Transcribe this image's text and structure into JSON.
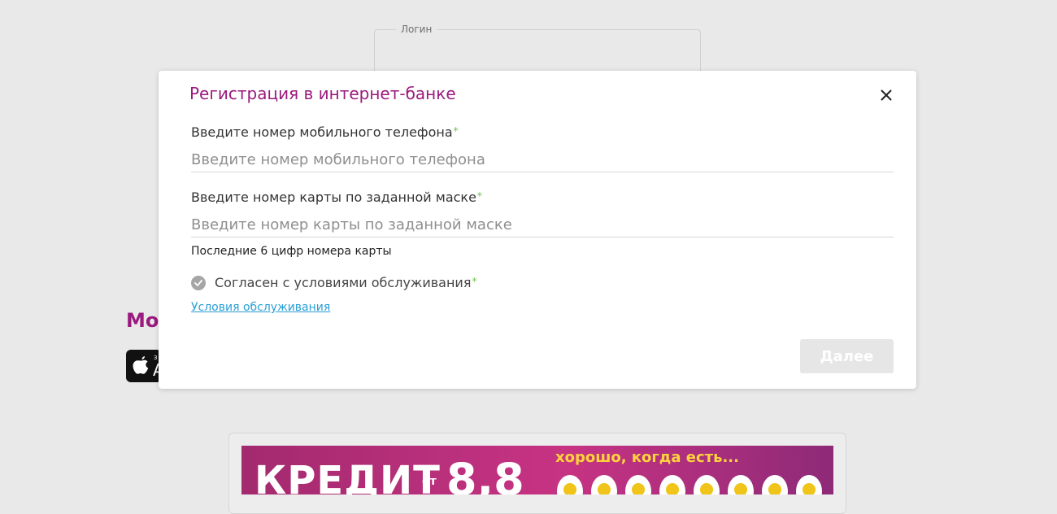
{
  "background": {
    "login_legend": "Логин",
    "mobile_title": "Мобильный банк",
    "appstore_small": "З",
    "appstore_big": "A",
    "banner": {
      "word": "КРЕДИТ",
      "from": "от",
      "number": "8,8",
      "slogan": "хорошо, когда есть..."
    }
  },
  "modal": {
    "title": "Регистрация в интернет-банке",
    "close_icon": "close-icon",
    "phone": {
      "label": "Введите номер мобильного телефона",
      "required_mark": "*",
      "placeholder": "Введите номер мобильного телефона",
      "value": ""
    },
    "card": {
      "label": "Введите номер карты по заданной маске",
      "required_mark": "*",
      "placeholder": "Введите номер карты по заданной маске",
      "value": ""
    },
    "card_hint": "Последние 6 цифр номера карты",
    "agree": {
      "label": "Согласен с условиями обслуживания",
      "required_mark": "*",
      "checked": true
    },
    "terms_link": "Условия обслуживания",
    "next_label": "Далее"
  },
  "colors": {
    "brand": "#9a1a7e",
    "required": "#6cc04a",
    "link": "#2a9fd6",
    "disabled_button": "#e6e6e6"
  }
}
